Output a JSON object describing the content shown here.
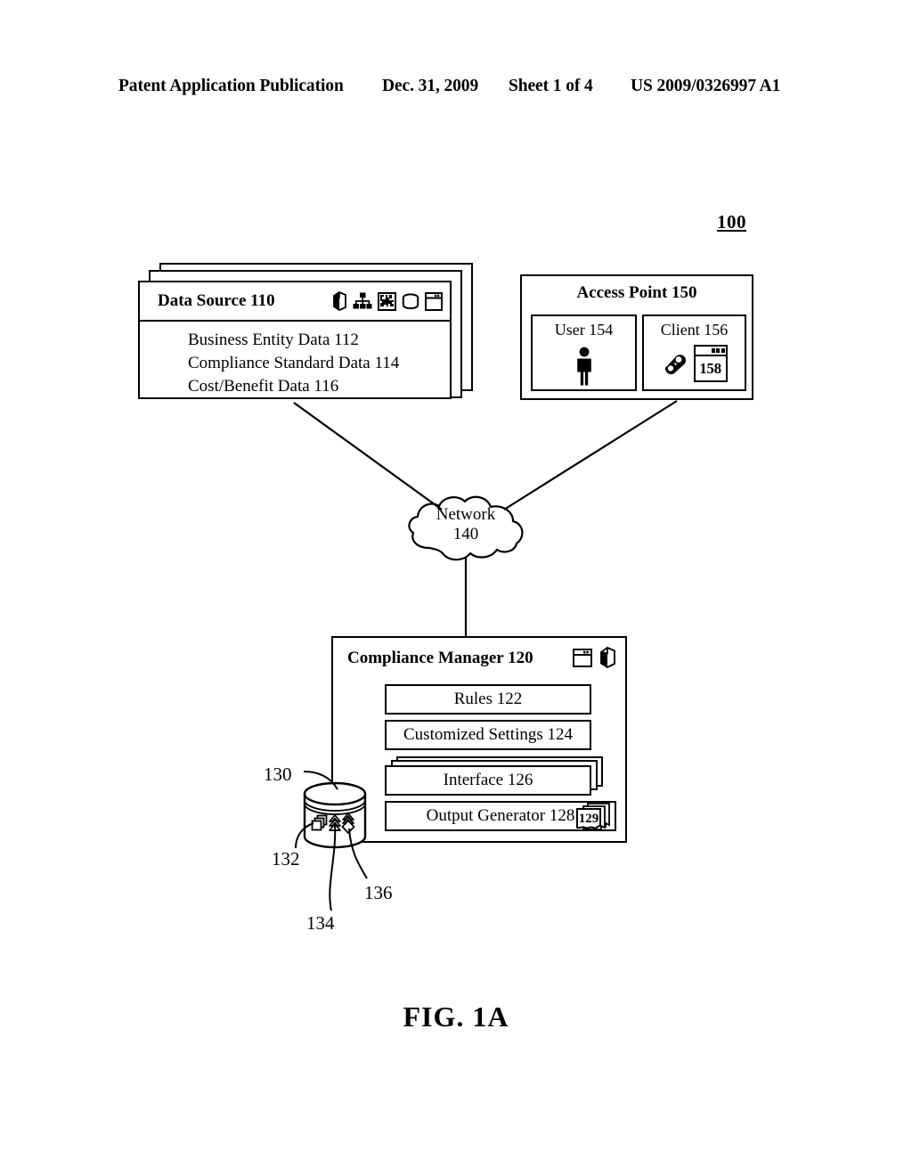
{
  "page_header": {
    "publication": "Patent Application Publication",
    "date": "Dec. 31, 2009",
    "sheet": "Sheet 1 of 4",
    "patent_number": "US 2009/0326997 A1"
  },
  "figure": {
    "system_reference": "100",
    "caption": "FIG. 1A"
  },
  "data_source": {
    "title": "Data Source 110",
    "icons": [
      "cube-icon",
      "network-tree-icon",
      "chip-grid-icon",
      "database-icon",
      "window-icon"
    ],
    "items": [
      "Business Entity Data 112",
      "Compliance Standard Data 114",
      "Cost/Benefit Data 116"
    ]
  },
  "access_point": {
    "title": "Access Point 150",
    "user": {
      "label": "User 154",
      "icon": "person-icon"
    },
    "client": {
      "label": "Client 156",
      "icon": "telephone-icon",
      "window_label": "158"
    }
  },
  "network": {
    "name": "Network",
    "reference": "140"
  },
  "compliance_manager": {
    "title": "Compliance Manager 120",
    "icons": [
      "window-icon",
      "cube-icon"
    ],
    "rows": [
      {
        "label": "Rules 122"
      },
      {
        "label": "Customized Settings 124"
      },
      {
        "label": "Interface 126"
      },
      {
        "label": "Output Generator 128"
      }
    ],
    "output_badge": "129"
  },
  "database": {
    "reference": "130",
    "contents": [
      {
        "reference": "132",
        "icon": "stacked-squares-icon"
      },
      {
        "reference": "134",
        "icon": "stacked-chevrons-icon"
      },
      {
        "reference": "136",
        "icon": "stacked-diamonds-icon"
      }
    ]
  }
}
